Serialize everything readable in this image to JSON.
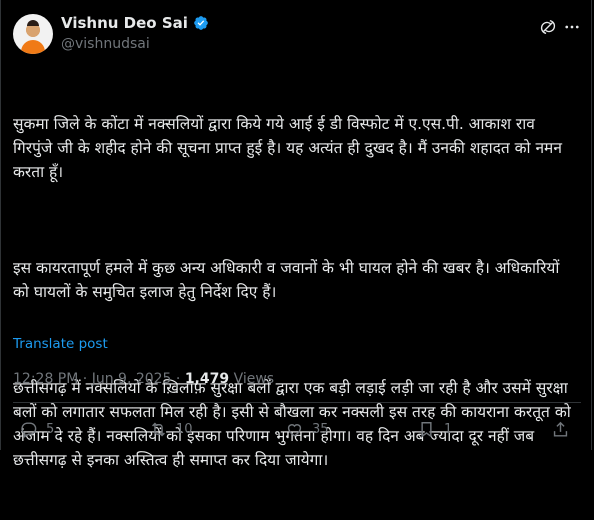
{
  "author": {
    "name": "Vishnu Deo Sai",
    "handle": "@vishnudsai"
  },
  "icons": {
    "verified": "verified-badge-icon",
    "grok": "grok-icon",
    "more": "more-icon",
    "reply": "reply-icon",
    "repost": "repost-icon",
    "like": "like-icon",
    "bookmark": "bookmark-icon",
    "share": "share-icon"
  },
  "colors": {
    "accent": "#1d9bf0",
    "muted": "#71767b",
    "text": "#e7e9ea",
    "background": "#000000"
  },
  "tweet": {
    "paragraphs": [
      "सुकमा जिले के कोंटा में नक्सलियों द्वारा किये गये आई ई डी विस्फोट में ए.एस.पी. आकाश राव गिरपुंजे जी के शहीद होने की सूचना प्राप्त हुई है। यह अत्यंत ही दुखद है। मैं उनकी शहादत को नमन करता हूँ।",
      "इस कायरतापूर्ण हमले में कुछ अन्य अधिकारी व जवानों के भी घायल होने की खबर है। अधिकारियों को घायलों के समुचित इलाज हेतु निर्देश दिए हैं।",
      "छत्तीसगढ़ में नक्सलियों के ख़िलाफ़ सुरक्षा बलों द्वारा एक बड़ी लड़ाई लड़ी जा रही है और उसमें सुरक्षा बलों को लगातार सफलता मिल रही है। इसी से बौखला कर नक्सली इस तरह की कायराना करतूत को अंजाम दे रहे हैं। नक्सलियों को इसका परिणाम भुगतना होगा। वह दिन अब ज्यादा दूर नहीं जब छत्तीसगढ़ से इनका अस्तित्व ही समाप्त कर दिया जायेगा।"
    ],
    "translate_label": "Translate post"
  },
  "meta": {
    "time": "12:28 PM",
    "sep1": "·",
    "date": "Jun 9, 2025",
    "sep2": "·",
    "views_count": "1,479",
    "views_label": "Views"
  },
  "actions": {
    "replies": "5",
    "reposts": "10",
    "likes": "35",
    "bookmarks": "1"
  }
}
